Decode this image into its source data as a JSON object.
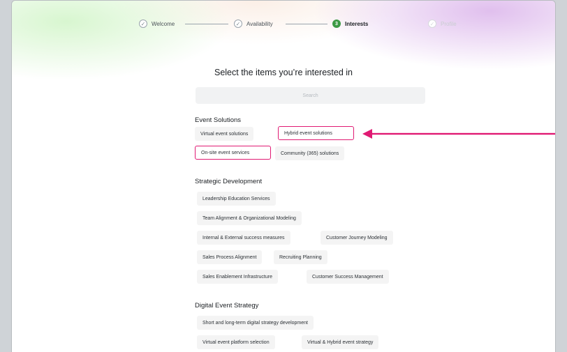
{
  "stepper": {
    "steps": [
      {
        "label": "Welcome",
        "marker": "✓",
        "state": "done"
      },
      {
        "label": "Availability",
        "marker": "✓",
        "state": "done"
      },
      {
        "label": "Interests",
        "marker": "3",
        "state": "active"
      },
      {
        "label": "Profile",
        "marker": "✓",
        "state": "future"
      }
    ]
  },
  "heading": "Select the items you’re interested in",
  "search": {
    "placeholder": "Search"
  },
  "sections": [
    {
      "title": "Event Solutions",
      "chips": [
        {
          "label": "Virtual event solutions",
          "highlighted": false
        },
        {
          "label": "Hybrid event solutions",
          "highlighted": true
        },
        {
          "label": "On-site event services",
          "highlighted": true
        },
        {
          "label": "Community (365) solutions",
          "highlighted": false
        }
      ]
    },
    {
      "title": "Strategic Development",
      "chips": [
        {
          "label": "Leadership Education Services"
        },
        {
          "label": "Team Alignment & Organizational Modeling"
        },
        {
          "label": "Internal & External success measures"
        },
        {
          "label": "Customer Journey Modeling"
        },
        {
          "label": "Sales Process Alignment"
        },
        {
          "label": "Recruiting Planning"
        },
        {
          "label": "Sales Enablement Infrastructure"
        },
        {
          "label": "Customer Success Management"
        }
      ]
    },
    {
      "title": "Digital Event Strategy",
      "chips": [
        {
          "label": "Short and long-term digital strategy development"
        },
        {
          "label": "Virtual event platform selection"
        },
        {
          "label": "Virtual & Hybrid event strategy"
        }
      ]
    }
  ],
  "colors": {
    "highlight": "#e01a73",
    "active_step": "#3d9a45"
  },
  "annotation": {
    "icon": "arrow-left-icon"
  }
}
